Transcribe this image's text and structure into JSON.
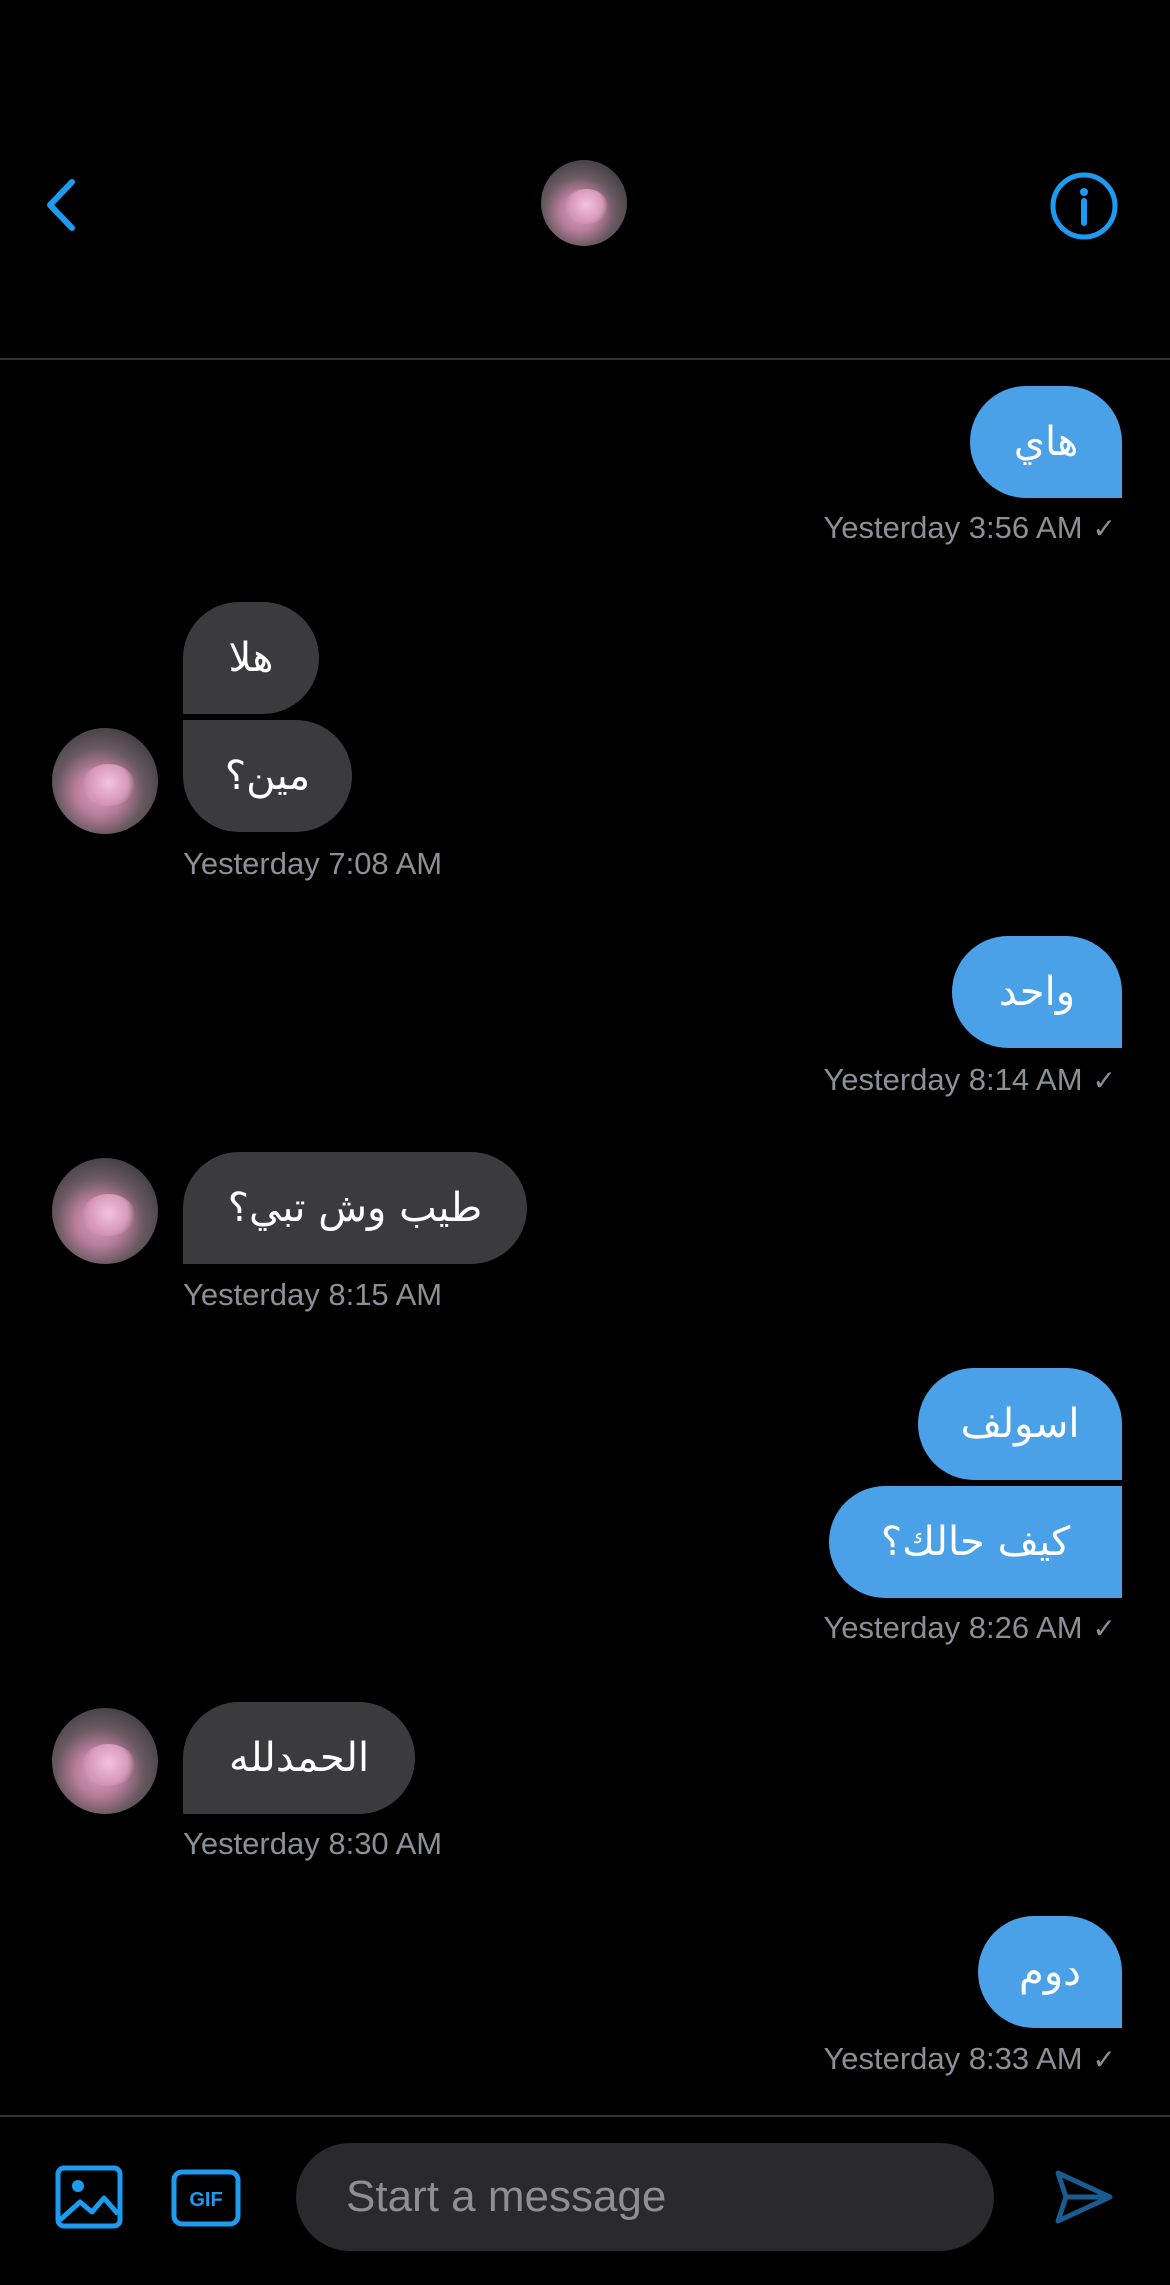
{
  "header": {
    "back_icon": "chevron-left-icon",
    "info_icon": "info-circle-icon",
    "accent_color": "#1d9bf0"
  },
  "messages": [
    {
      "id": "m1",
      "direction": "outgoing",
      "text": "هاي",
      "timestamp": "Yesterday 3:56 AM",
      "read": true
    },
    {
      "id": "m2",
      "direction": "incoming",
      "text": "هلا"
    },
    {
      "id": "m3",
      "direction": "incoming",
      "text": "مين؟",
      "timestamp": "Yesterday 7:08 AM"
    },
    {
      "id": "m4",
      "direction": "outgoing",
      "text": "واحد",
      "timestamp": "Yesterday 8:14 AM",
      "read": true
    },
    {
      "id": "m5",
      "direction": "incoming",
      "text": "طيب وش تبي؟",
      "timestamp": "Yesterday 8:15 AM"
    },
    {
      "id": "m6",
      "direction": "outgoing",
      "text": "اسولف"
    },
    {
      "id": "m7",
      "direction": "outgoing",
      "text": "كيف حالك؟",
      "timestamp": "Yesterday 8:26 AM",
      "read": true
    },
    {
      "id": "m8",
      "direction": "incoming",
      "text": "الحمدلله",
      "timestamp": "Yesterday 8:30 AM"
    },
    {
      "id": "m9",
      "direction": "outgoing",
      "text": "دوم",
      "timestamp": "Yesterday 8:33 AM",
      "read": true
    }
  ],
  "composer": {
    "image_icon": "image-icon",
    "gif_label": "GIF",
    "placeholder": "Start a message",
    "send_icon": "send-icon"
  },
  "colors": {
    "outgoing_bubble": "#4ba1e8",
    "incoming_bubble": "#3b3b3d",
    "timestamp": "#8b9096",
    "background": "#000000"
  }
}
